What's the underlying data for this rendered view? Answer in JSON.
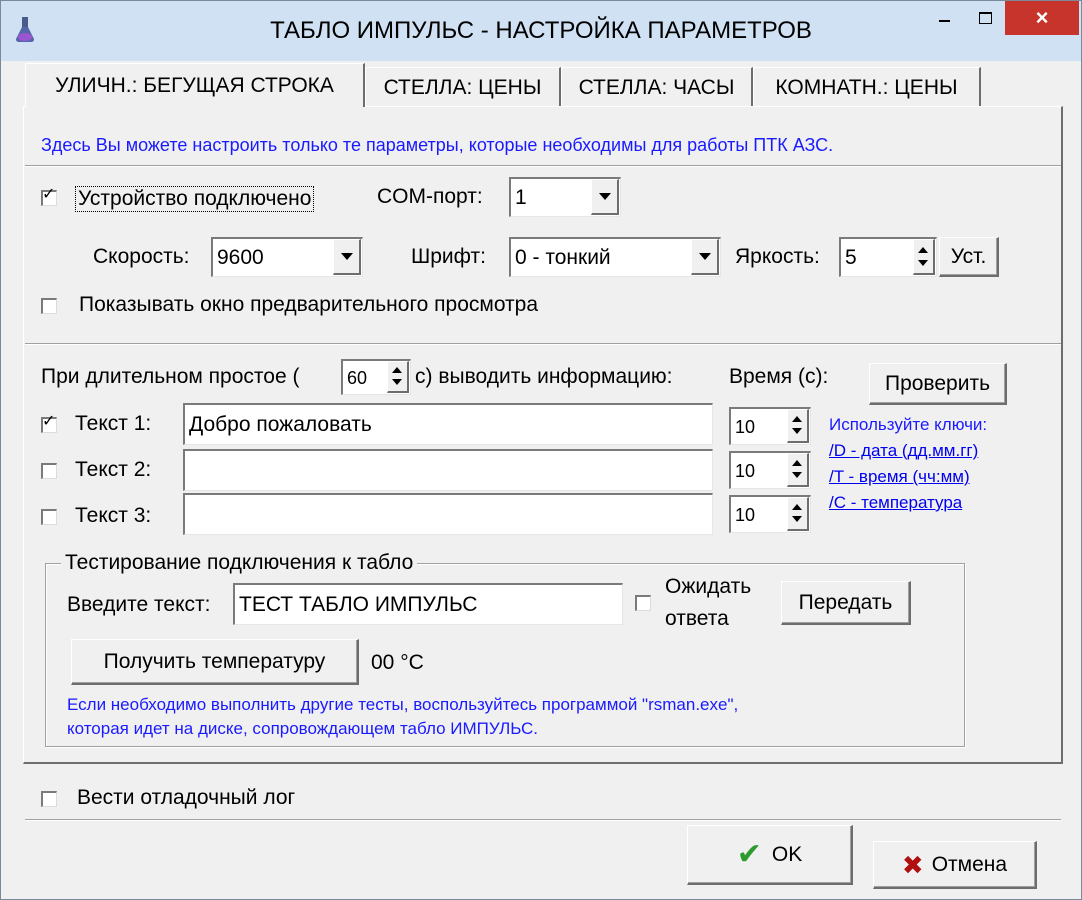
{
  "window": {
    "title": "ТАБЛО ИМПУЛЬС - НАСТРОЙКА ПАРАМЕТРОВ",
    "minimize": "–",
    "maximize": "□",
    "close": "×"
  },
  "tabs": [
    {
      "label": "УЛИЧН.: БЕГУЩАЯ СТРОКА",
      "active": true
    },
    {
      "label": "СТЕЛЛА: ЦЕНЫ",
      "active": false
    },
    {
      "label": "СТЕЛЛА: ЧАСЫ",
      "active": false
    },
    {
      "label": "КОМНАТН.: ЦЕНЫ",
      "active": false
    }
  ],
  "info": "Здесь Вы можете настроить только те параметры, которые необходимы для работы ПТК АЗС.",
  "device": {
    "connected_label": "Устройство подключено",
    "connected": true,
    "com_label": "COM-порт:",
    "com_value": "1",
    "speed_label": "Скорость:",
    "speed_value": "9600",
    "font_label": "Шрифт:",
    "font_value": "0 - тонкий",
    "brightness_label": "Яркость:",
    "brightness_value": "5",
    "set_button": "Уст.",
    "preview_label": "Показывать окно предварительного просмотра",
    "preview_checked": false
  },
  "idle": {
    "prefix": "При длительном простое (",
    "seconds": "60",
    "suffix": "с) выводить информацию:",
    "time_label": "Время (с):",
    "check_button": "Проверить"
  },
  "texts": [
    {
      "label": "Текст 1:",
      "checked": true,
      "value": "Добро пожаловать",
      "time": "10"
    },
    {
      "label": "Текст 2:",
      "checked": false,
      "value": "",
      "time": "10"
    },
    {
      "label": "Текст 3:",
      "checked": false,
      "value": "",
      "time": "10"
    }
  ],
  "keys": {
    "title": "Используйте ключи:",
    "date": "/D - дата (дд.мм.гг)",
    "time": "/T - время (чч:мм)",
    "temp": "/C - температура"
  },
  "test": {
    "group_title": "Тестирование подключения к табло",
    "input_label": "Введите текст:",
    "input_value": "ТЕСТ ТАБЛО ИМПУЛЬС",
    "wait_label_1": "Ожидать",
    "wait_label_2": "ответа",
    "wait_checked": false,
    "send_button": "Передать",
    "temp_button": "Получить температуру",
    "temp_value": "00 °C",
    "note_1": "Если необходимо выполнить другие тесты, воспользуйтесь программой \"rsman.exe\",",
    "note_2": "которая идет на диске, сопровождающем табло ИМПУЛЬС."
  },
  "log": {
    "label": "Вести отладочный лог",
    "checked": false
  },
  "footer": {
    "ok": "OK",
    "cancel": "Отмена"
  },
  "colors": {
    "title_bg": "#cfe1f3",
    "close_bg": "#c7342c",
    "info_text": "#1a1aff",
    "link": "#0000ee",
    "ok_check": "#2e9b2e",
    "cancel_x": "#b01010"
  }
}
